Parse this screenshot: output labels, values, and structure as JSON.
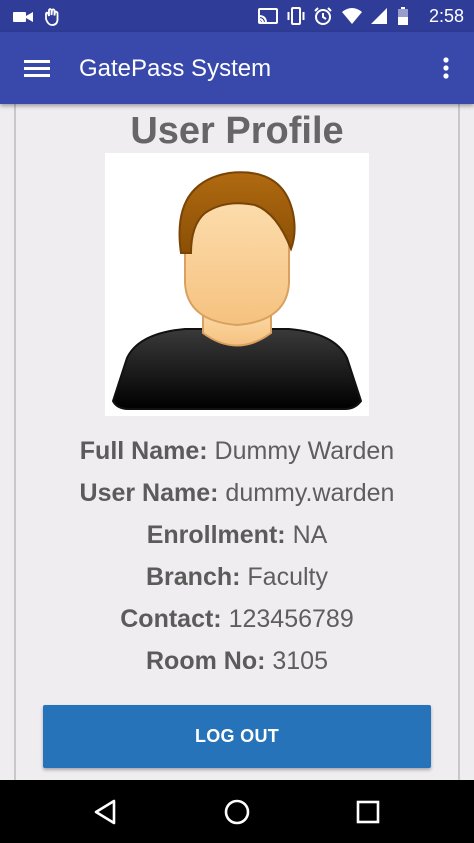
{
  "status_bar": {
    "time": "2:58",
    "icons": [
      "video-camera-icon",
      "touch-hand-icon",
      "cast-icon",
      "vibrate-icon",
      "alarm-icon",
      "wifi-icon",
      "cell-signal-icon",
      "battery-icon"
    ]
  },
  "app_bar": {
    "title": "GatePass System",
    "menu_icon": "hamburger-menu-icon",
    "overflow_icon": "more-vert-icon",
    "color": "#3949ab"
  },
  "profile": {
    "title": "User Profile",
    "avatar_icon": "user-avatar-icon",
    "fields": [
      {
        "label": "Full Name:",
        "value": "Dummy Warden"
      },
      {
        "label": "User Name:",
        "value": "dummy.warden"
      },
      {
        "label": "Enrollment:",
        "value": "NA"
      },
      {
        "label": "Branch:",
        "value": "Faculty"
      },
      {
        "label": "Contact:",
        "value": "123456789"
      },
      {
        "label": "Room No:",
        "value": "3105"
      }
    ]
  },
  "logout": {
    "label": "LOG OUT",
    "color": "#2673b9"
  },
  "nav_bar": {
    "icons": [
      "back-icon",
      "home-icon",
      "recents-icon"
    ]
  }
}
